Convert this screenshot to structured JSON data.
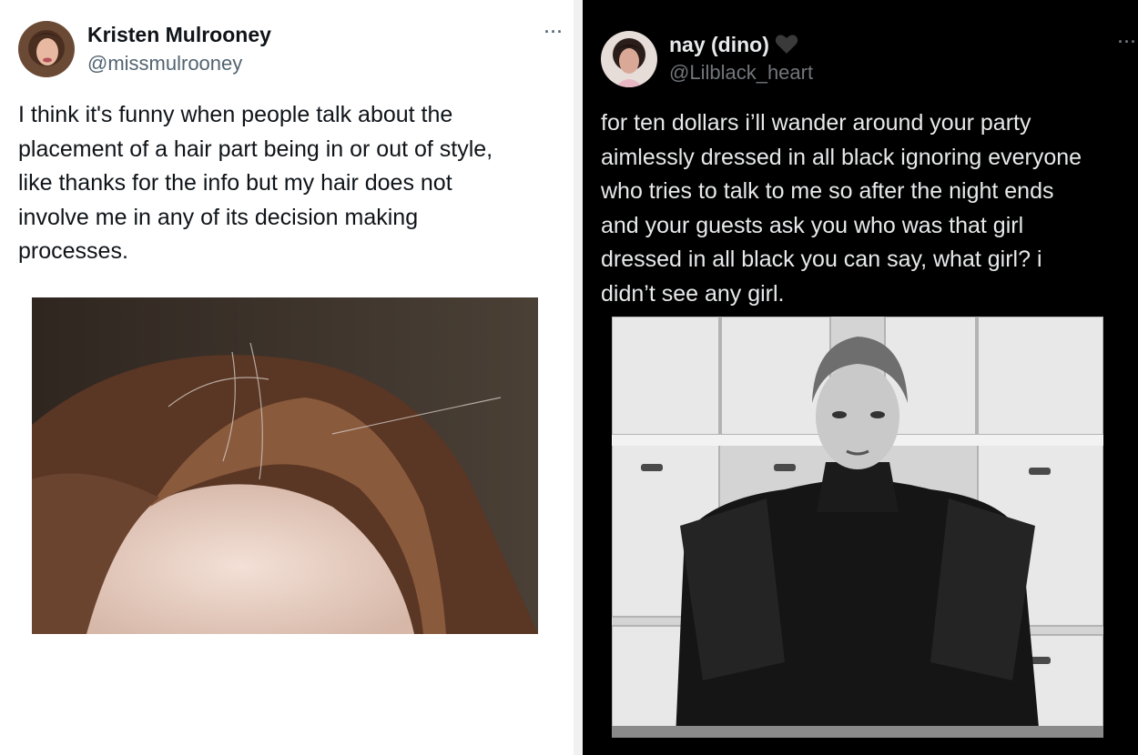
{
  "tweets": [
    {
      "name": "Kristen Mulrooney",
      "handle": "@missmulrooney",
      "more_label": "···",
      "text": "I think it's funny when people talk about the\nplacement of a hair part being in or out of style,\nlike thanks for the info but my hair does not\ninvolve me in any of its decision making\nprocesses."
    },
    {
      "name": "nay (dino)",
      "name_emoji": "black-heart-icon",
      "handle": "@Lilblack_heart",
      "more_label": "···",
      "text": "for ten dollars i’ll wander around your party\naimlessly dressed in all black ignoring everyone\nwho tries to talk to me so after the night ends\nand your guests ask you who was that girl\ndressed in all black you can say, what girl? i\ndidn’t see any girl."
    }
  ],
  "colors": {
    "light_bg": "#ffffff",
    "dark_bg": "#000000",
    "light_text": "#0f1419",
    "light_secondary": "#536471",
    "dark_text": "#e7e9ea",
    "dark_secondary": "#71767b"
  }
}
